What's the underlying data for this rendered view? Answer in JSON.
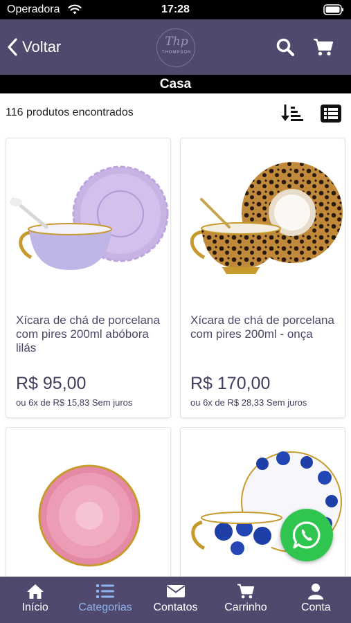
{
  "status_bar": {
    "carrier": "Operadora",
    "time": "17:28"
  },
  "header": {
    "back_label": "Voltar",
    "logo_script": "Thp",
    "logo_word": "THOMPSON"
  },
  "category_title": "Casa",
  "result_count": "116 produtos encontrados",
  "colors": {
    "header_bg": "#4f4a6d",
    "text_primary": "#4b4868",
    "tab_active": "#8fb4ee",
    "whatsapp": "#2fc54f"
  },
  "products": [
    {
      "name": "Xícara de chá de porcelana com pires 200ml  abóbora lilás",
      "price": "R$ 95,00",
      "installment": "ou 6x de R$ 15,83 Sem juros"
    },
    {
      "name": "Xícara de chá de porcelana com pires 200ml - onça",
      "price": "R$ 170,00",
      "installment": "ou 6x de R$ 28,33 Sem juros"
    },
    {
      "name": "",
      "price": "",
      "installment": ""
    },
    {
      "name": "",
      "price": "",
      "installment": ""
    }
  ],
  "tabs": [
    {
      "label": "Início",
      "icon": "home-icon",
      "active": false
    },
    {
      "label": "Categorias",
      "icon": "list-icon",
      "active": true
    },
    {
      "label": "Contatos",
      "icon": "mail-icon",
      "active": false
    },
    {
      "label": "Carrinho",
      "icon": "cart-icon",
      "active": false
    },
    {
      "label": "Conta",
      "icon": "user-icon",
      "active": false
    }
  ]
}
